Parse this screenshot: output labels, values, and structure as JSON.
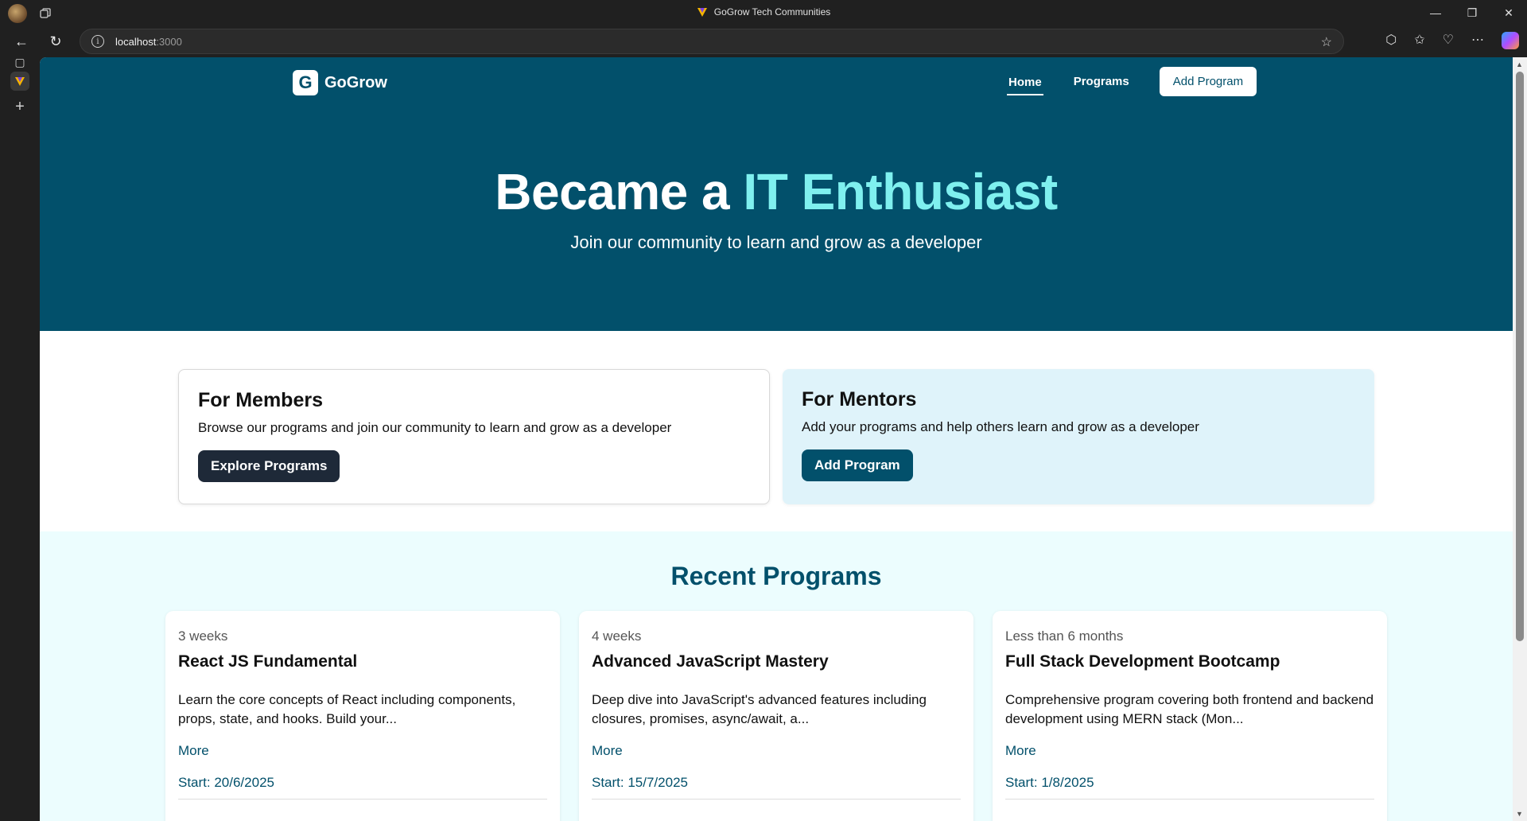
{
  "browser": {
    "tab_title": "GoGrow Tech Communities",
    "url_host": "localhost",
    "url_port": ":3000"
  },
  "header": {
    "logo_text": "GoGrow",
    "nav": [
      {
        "label": "Home",
        "active": true
      },
      {
        "label": "Programs",
        "active": false
      }
    ],
    "add_program_label": "Add Program"
  },
  "hero": {
    "title_prefix": "Became a",
    "title_accent": "IT Enthusiast",
    "subtitle": "Join our community to learn and grow as a developer",
    "accent_color": "#7ff0ef",
    "background_color": "#02506b"
  },
  "roles": {
    "members": {
      "title": "For Members",
      "text": "Browse our programs and join our community to learn and grow as a developer",
      "button": "Explore Programs"
    },
    "mentors": {
      "title": "For Mentors",
      "text": "Add your programs and help others learn and grow as a developer",
      "button": "Add Program"
    }
  },
  "recent": {
    "heading": "Recent Programs",
    "programs": [
      {
        "duration": "3 weeks",
        "title": "React JS Fundamental",
        "description": "Learn the core concepts of React including components, props, state, and hooks. Build your...",
        "more": "More",
        "start": "Start: 20/6/2025"
      },
      {
        "duration": "4 weeks",
        "title": "Advanced JavaScript Mastery",
        "description": "Deep dive into JavaScript's advanced features including closures, promises, async/await, a...",
        "more": "More",
        "start": "Start: 15/7/2025"
      },
      {
        "duration": "Less than 6 months",
        "title": "Full Stack Development Bootcamp",
        "description": "Comprehensive program covering both frontend and backend development using MERN stack (Mon...",
        "more": "More",
        "start": "Start: 1/8/2025"
      }
    ]
  }
}
